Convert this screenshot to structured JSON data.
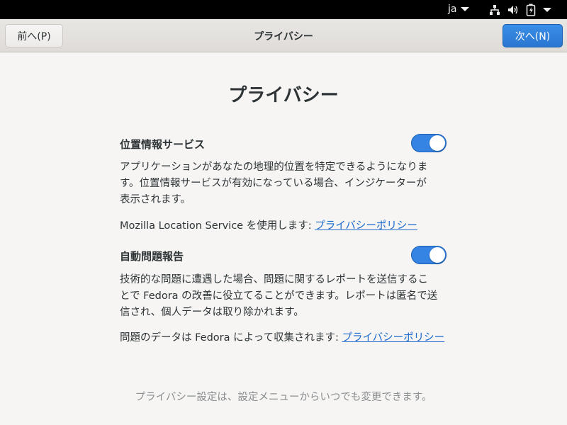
{
  "system_bar": {
    "language": "ja",
    "icons": [
      "network-icon",
      "volume-icon",
      "battery-icon",
      "system-menu-caret-icon"
    ]
  },
  "header": {
    "prev_label": "前へ(P)",
    "title": "プライバシー",
    "next_label": "次へ(N)"
  },
  "page": {
    "title": "プライバシー"
  },
  "location_services": {
    "title": "位置情報サービス",
    "enabled": true,
    "description_lines": [
      "アプリケーションがあなたの地理的位置を特定できるようになりま",
      "す。位置情報サービスが有効になっている場合、インジケーターが",
      "表示されます。"
    ],
    "policy_prefix": "Mozilla Location Service を使用します: ",
    "policy_link": "プライバシーポリシー"
  },
  "problem_reporting": {
    "title": "自動問題報告",
    "enabled": true,
    "description_lines": [
      "技術的な問題に遭遇した場合、問題に関するレポートを送信するこ",
      "とで Fedora の改善に役立てることができます。レポートは匿名で送",
      "信され、個人データは取り除かれます。"
    ],
    "policy_prefix": "問題のデータは Fedora によって収集されます: ",
    "policy_link": "プライバシーポリシー"
  },
  "footer_note": "プライバシー設定は、設定メニューからいつでも変更できます。",
  "colors": {
    "accent": "#3584e4",
    "link": "#1b6acb",
    "muted_text": "#8b8e8f"
  }
}
